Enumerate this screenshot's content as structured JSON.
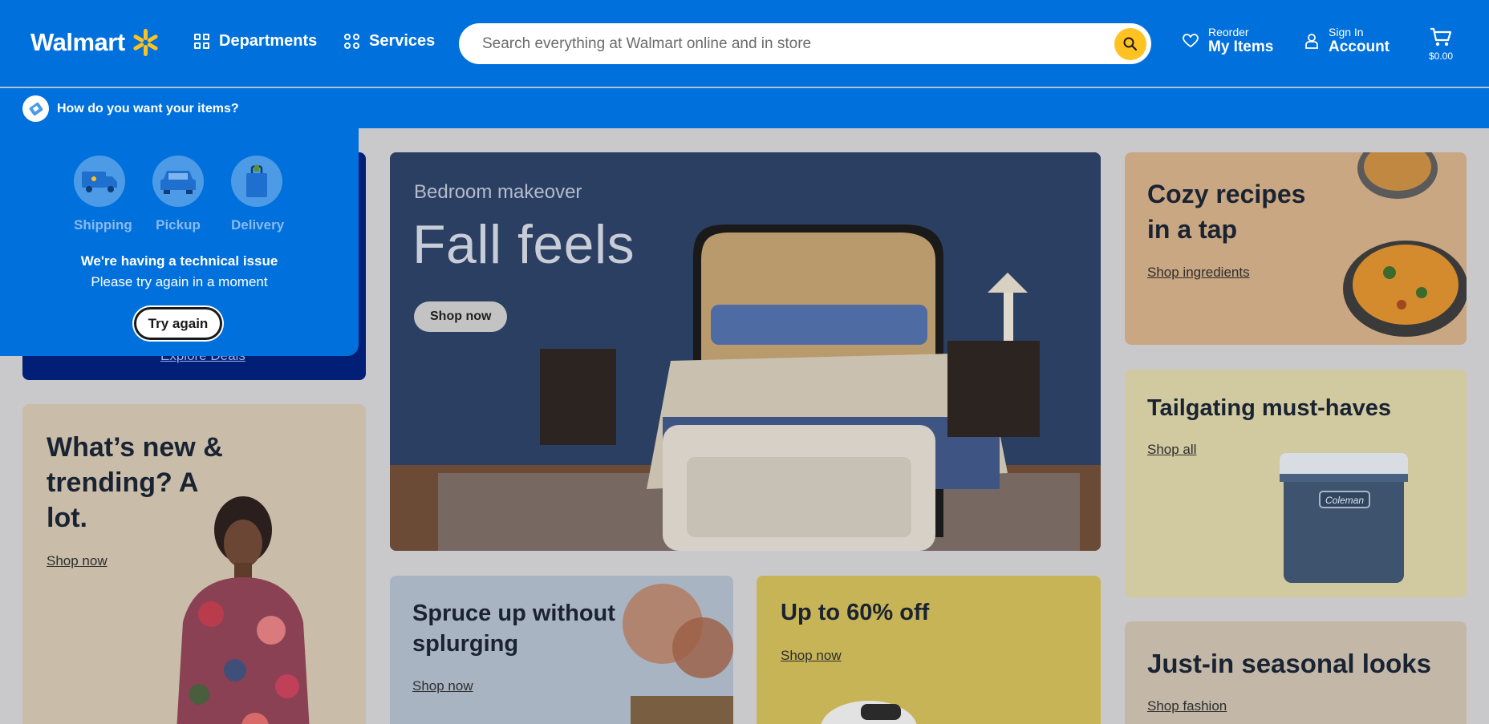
{
  "header": {
    "logo_text": "Walmart",
    "departments_label": "Departments",
    "services_label": "Services",
    "search_placeholder": "Search everything at Walmart online and in store",
    "reorder_small": "Reorder",
    "reorder_big": "My Items",
    "signin_small": "Sign In",
    "signin_big": "Account",
    "cart_amount": "$0.00",
    "brand_color": "#0071dc",
    "accent_color": "#ffc220"
  },
  "fulfillment": {
    "prompt": "How do you want your items?",
    "options": [
      {
        "label": "Shipping",
        "icon": "truck-icon"
      },
      {
        "label": "Pickup",
        "icon": "car-icon"
      },
      {
        "label": "Delivery",
        "icon": "bag-icon"
      }
    ],
    "error_title": "We're having a technical issue",
    "error_text": "Please try again in a moment",
    "retry_label": "Try again"
  },
  "cards": {
    "deals": {
      "link": "Explore Deals"
    },
    "trending": {
      "title": "What’s new & trending? A lot.",
      "link": "Shop now"
    },
    "hero": {
      "subtitle": "Bedroom makeover",
      "title": "Fall feels",
      "button": "Shop now"
    },
    "cozy": {
      "title": "Cozy recipes in a tap",
      "link": "Shop ingredients"
    },
    "tailgating": {
      "title": "Tailgating must-haves",
      "link": "Shop all",
      "product_brand": "Coleman"
    },
    "seasonal": {
      "title": "Just-in seasonal looks",
      "link": "Shop fashion"
    },
    "spruce": {
      "title": "Spruce up without splurging",
      "link": "Shop now"
    },
    "sixty": {
      "title": "Up to 60% off",
      "link": "Shop now"
    }
  }
}
